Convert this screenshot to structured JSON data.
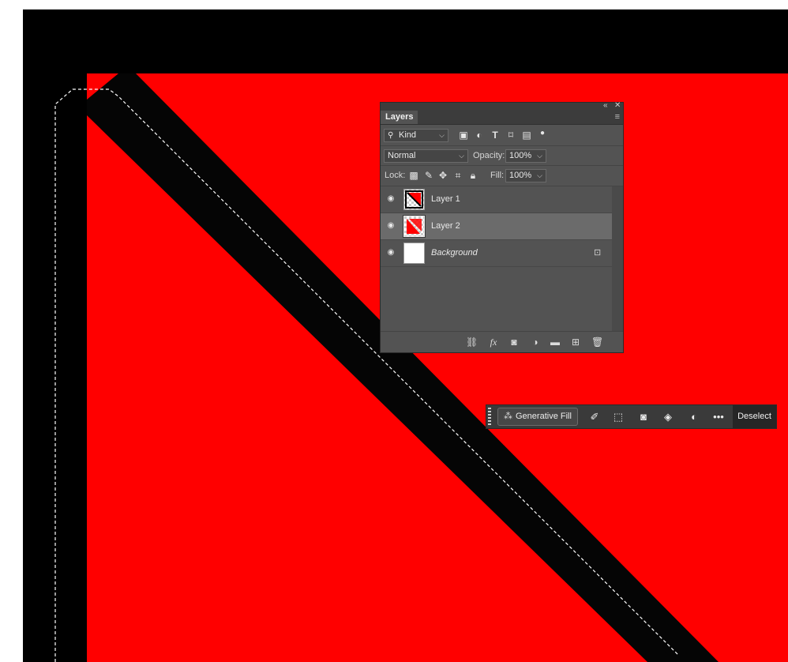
{
  "layers_panel": {
    "title": "Layers",
    "filter_kind_label": "Kind",
    "blend_mode": "Normal",
    "opacity_label": "Opacity:",
    "opacity_value": "100%",
    "lock_label": "Lock:",
    "fill_label": "Fill:",
    "fill_value": "100%",
    "layers": [
      {
        "name": "Layer 1",
        "visible": true,
        "selected": false
      },
      {
        "name": "Layer 2",
        "visible": true,
        "selected": true
      },
      {
        "name": "Background",
        "visible": true,
        "selected": false,
        "locked": true
      }
    ],
    "panel_controls": {
      "collapse": "«",
      "close": "✕",
      "menu": "≡"
    }
  },
  "contextual_task_bar": {
    "generative_fill_label": "Generative Fill",
    "deselect_label": "Deselect",
    "icons": [
      "brush-modify-icon",
      "invert-selection-icon",
      "mask-icon",
      "fill-bucket-icon",
      "adjustment-icon",
      "more-icon"
    ]
  },
  "colors": {
    "canvas_red": "#ff0000",
    "canvas_black": "#000000",
    "panel_bg": "#535353",
    "selected_layer_bg": "#6b6b6b"
  }
}
